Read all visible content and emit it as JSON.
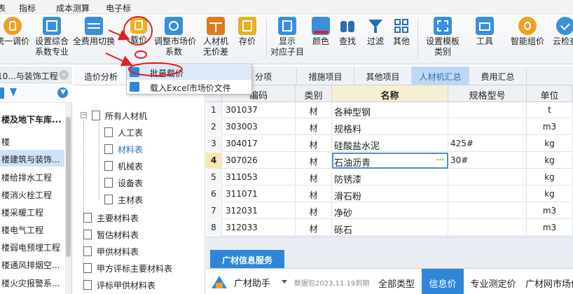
{
  "menubar": {
    "items": [
      {
        "label": "表"
      },
      {
        "label": "指标"
      },
      {
        "label": "成本测算"
      },
      {
        "label": "电子标"
      }
    ]
  },
  "ribbon": {
    "tools": [
      {
        "line1": "统一调价"
      },
      {
        "line1": "设置综合",
        "line2": "系数专业"
      },
      {
        "line1": "全费用切换"
      },
      {
        "line1": "载价"
      },
      {
        "line1": "调整市场价",
        "line2": "系数"
      },
      {
        "line1": "人材机",
        "line2": "无价差"
      },
      {
        "line1": "存价"
      },
      {
        "line1": "显示",
        "line2": "对应子目"
      },
      {
        "line1": "颜色"
      },
      {
        "line1": "查找"
      },
      {
        "line1": "过滤"
      },
      {
        "line1": "其他"
      },
      {
        "line1": "设置模板",
        "line2": "类别"
      },
      {
        "line1": "工具"
      },
      {
        "line1": "智能组价"
      },
      {
        "line1": "云检查"
      }
    ]
  },
  "dropdown": {
    "items": [
      {
        "label": "批量载价"
      },
      {
        "label": "载入Excel市场价文件"
      }
    ]
  },
  "left_panel": {
    "header": "10...与装饰工程",
    "projects": [
      {
        "label": "楼及地下车库..."
      },
      {
        "label": "楼"
      },
      {
        "label": "楼建筑与装饰..."
      },
      {
        "label": "楼给排水工程"
      },
      {
        "label": "楼消火栓工程"
      },
      {
        "label": "楼采暖工程"
      },
      {
        "label": "楼电气工程"
      },
      {
        "label": "楼弱电预埋工程"
      },
      {
        "label": "楼通风排烟空..."
      },
      {
        "label": "楼火灾报警系..."
      }
    ]
  },
  "mid_panel": {
    "tab": "造价分析",
    "tree": {
      "root": "所有人材机",
      "children": [
        "人工表",
        "材料表",
        "机械表",
        "设备表",
        "主材表"
      ],
      "groups": [
        "主要材料表",
        "暂估材料表",
        "甲供材料表",
        "甲方评标主要材料表",
        "评标甲供材料表"
      ]
    }
  },
  "main_tabs": [
    {
      "label": "分项"
    },
    {
      "label": "措施项目"
    },
    {
      "label": "其他项目"
    },
    {
      "label": "人材机汇总"
    },
    {
      "label": "费用汇总"
    }
  ],
  "grid": {
    "columns": [
      "",
      "编码",
      "类别",
      "名称",
      "规格型号",
      "单位"
    ],
    "rows": [
      {
        "num": "1",
        "code": "301037",
        "type": "材",
        "name": "各种型钢",
        "spec": "",
        "unit": "t"
      },
      {
        "num": "2",
        "code": "303003",
        "type": "材",
        "name": "规格料",
        "spec": "",
        "unit": "m3"
      },
      {
        "num": "3",
        "code": "304017",
        "type": "材",
        "name": "硅酸盐水泥",
        "spec": "425#",
        "unit": "kg"
      },
      {
        "num": "4",
        "code": "307026",
        "type": "材",
        "name": "石油沥青",
        "spec": "30#",
        "unit": "kg",
        "ellipsis": "···"
      },
      {
        "num": "5",
        "code": "311053",
        "type": "材",
        "name": "防锈漆",
        "spec": "",
        "unit": "kg"
      },
      {
        "num": "6",
        "code": "311071",
        "type": "材",
        "name": "滑石粉",
        "spec": "",
        "unit": "kg"
      },
      {
        "num": "7",
        "code": "312031",
        "type": "材",
        "name": "净砂",
        "spec": "",
        "unit": "m3"
      },
      {
        "num": "8",
        "code": "312033",
        "type": "材",
        "name": "砾石",
        "spec": "",
        "unit": "m3"
      }
    ]
  },
  "bottom": {
    "tab": "广材信息服务",
    "assistant": "广材助手",
    "data_pack": "数据包2023.11.19到期",
    "categories": [
      {
        "label": "全部类型"
      },
      {
        "label": "信息价"
      },
      {
        "label": "专业测定价"
      },
      {
        "label": "广材网市场价"
      }
    ]
  },
  "colors": {
    "accent": "#2f86d9",
    "annotation": "#e02020",
    "selected_tab": "#bed8f4"
  }
}
